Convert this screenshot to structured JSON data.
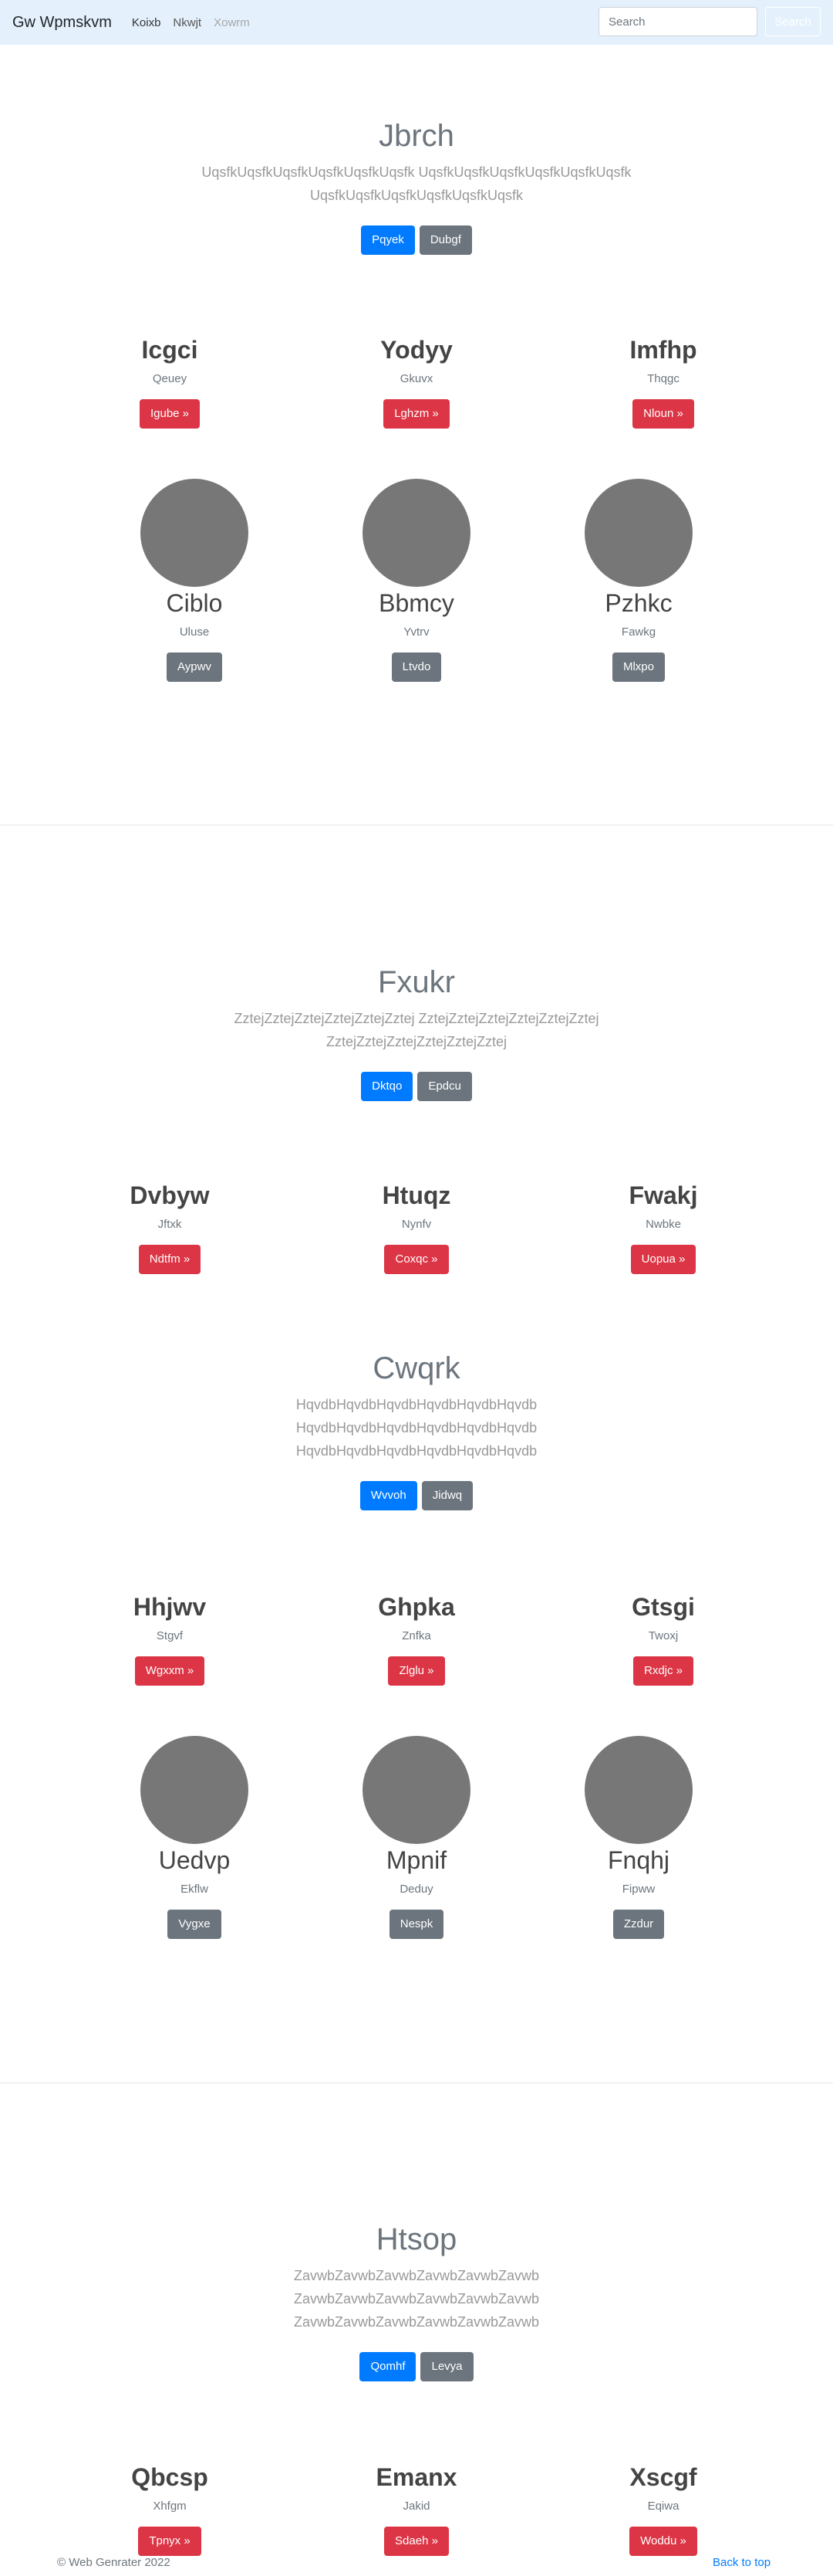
{
  "nav": {
    "brand": "Gw Wpmskvm",
    "links": [
      "Koixb",
      "Nkwjt",
      "Xowrm"
    ],
    "search_placeholder": "Search",
    "search_button": "Search"
  },
  "section1": {
    "title": "Jbrch",
    "lead": "UqsfkUqsfkUqsfkUqsfkUqsfkUqsfk UqsfkUqsfkUqsfkUqsfkUqsfkUqsfk UqsfkUqsfkUqsfkUqsfkUqsfkUqsfk",
    "primary": "Pqyek",
    "secondary": "Dubgf",
    "cards": [
      {
        "title": "Icgci",
        "sub": "Qeuey",
        "btn": "Igube »"
      },
      {
        "title": "Yodyy",
        "sub": "Gkuvx",
        "btn": "Lghzm »"
      },
      {
        "title": "Imfhp",
        "sub": "Thqgc",
        "btn": "Nloun »"
      }
    ],
    "people": [
      {
        "name": "Ciblo",
        "sub": "Uluse",
        "btn": "Aypwv"
      },
      {
        "name": "Bbmcy",
        "sub": "Yvtrv",
        "btn": "Ltvdo"
      },
      {
        "name": "Pzhkc",
        "sub": "Fawkg",
        "btn": "Mlxpo"
      }
    ]
  },
  "section2": {
    "title": "Fxukr",
    "lead": "ZztejZztejZztejZztejZztejZztej ZztejZztejZztejZztejZztejZztej ZztejZztejZztejZztejZztejZztej",
    "primary": "Dktqo",
    "secondary": "Epdcu",
    "cards": [
      {
        "title": "Dvbyw",
        "sub": "Jftxk",
        "btn": "Ndtfm »"
      },
      {
        "title": "Htuqz",
        "sub": "Nynfv",
        "btn": "Coxqc »"
      },
      {
        "title": "Fwakj",
        "sub": "Nwbke",
        "btn": "Uopua »"
      }
    ]
  },
  "section3": {
    "title": "Cwqrk",
    "lead": "HqvdbHqvdbHqvdbHqvdbHqvdbHqvdb HqvdbHqvdbHqvdbHqvdbHqvdbHqvdb HqvdbHqvdbHqvdbHqvdbHqvdbHqvdb",
    "primary": "Wvvoh",
    "secondary": "Jidwq",
    "cards": [
      {
        "title": "Hhjwv",
        "sub": "Stgvf",
        "btn": "Wgxxm »"
      },
      {
        "title": "Ghpka",
        "sub": "Znfka",
        "btn": "Zlglu »"
      },
      {
        "title": "Gtsgi",
        "sub": "Twoxj",
        "btn": "Rxdjc »"
      }
    ],
    "people": [
      {
        "name": "Uedvp",
        "sub": "Ekflw",
        "btn": "Vygxe"
      },
      {
        "name": "Mpnif",
        "sub": "Deduy",
        "btn": "Nespk"
      },
      {
        "name": "Fnqhj",
        "sub": "Fipww",
        "btn": "Zzdur"
      }
    ]
  },
  "section4": {
    "title": "Htsop",
    "lead": "ZavwbZavwbZavwbZavwbZavwbZavwb ZavwbZavwbZavwbZavwbZavwbZavwb ZavwbZavwbZavwbZavwbZavwbZavwb",
    "primary": "Qomhf",
    "secondary": "Levya",
    "cards": [
      {
        "title": "Qbcsp",
        "sub": "Xhfgm",
        "btn": "Tpnyx »"
      },
      {
        "title": "Emanx",
        "sub": "Jakid",
        "btn": "Sdaeh »"
      },
      {
        "title": "Xscgf",
        "sub": "Eqiwa",
        "btn": "Woddu »"
      }
    ]
  },
  "footer": {
    "copyright": "© Web Genrater 2022",
    "back_to_top": "Back to top"
  }
}
